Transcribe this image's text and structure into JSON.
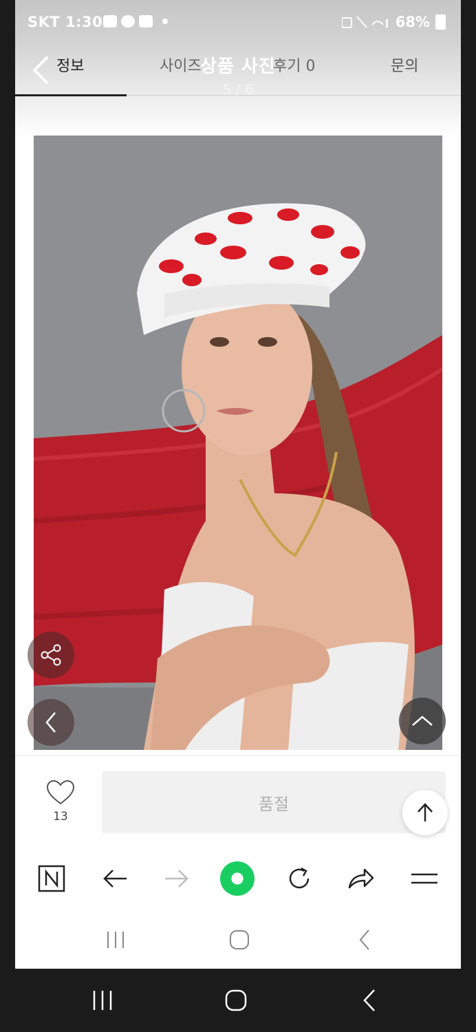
{
  "status_bar": {
    "carrier_time": "SKT 1:30",
    "battery": "68%"
  },
  "tabs": {
    "info": "정보",
    "size": "사이즈",
    "review": "후기 0",
    "qna": "문의"
  },
  "viewer": {
    "title": "상품 사진",
    "counter": "5 / 6"
  },
  "product_photo": {
    "description": "model wearing white beret with red lip prints"
  },
  "actions": {
    "like_count": "13",
    "soldout_label": "품절"
  },
  "colors": {
    "green_accent": "#19ce60",
    "red_backdrop": "#b81f2b"
  },
  "icons": {
    "like": "heart-icon",
    "share": "share-icon",
    "prev": "chevron-left-icon",
    "up": "chevron-up-icon",
    "scroll_top": "arrow-up-icon",
    "naver": "naver-n-icon",
    "back": "arrow-left-icon",
    "forward": "arrow-right-icon",
    "home": "green-dot-icon",
    "refresh": "refresh-icon",
    "share_browser": "forward-share-icon",
    "menu": "menu-icon"
  }
}
